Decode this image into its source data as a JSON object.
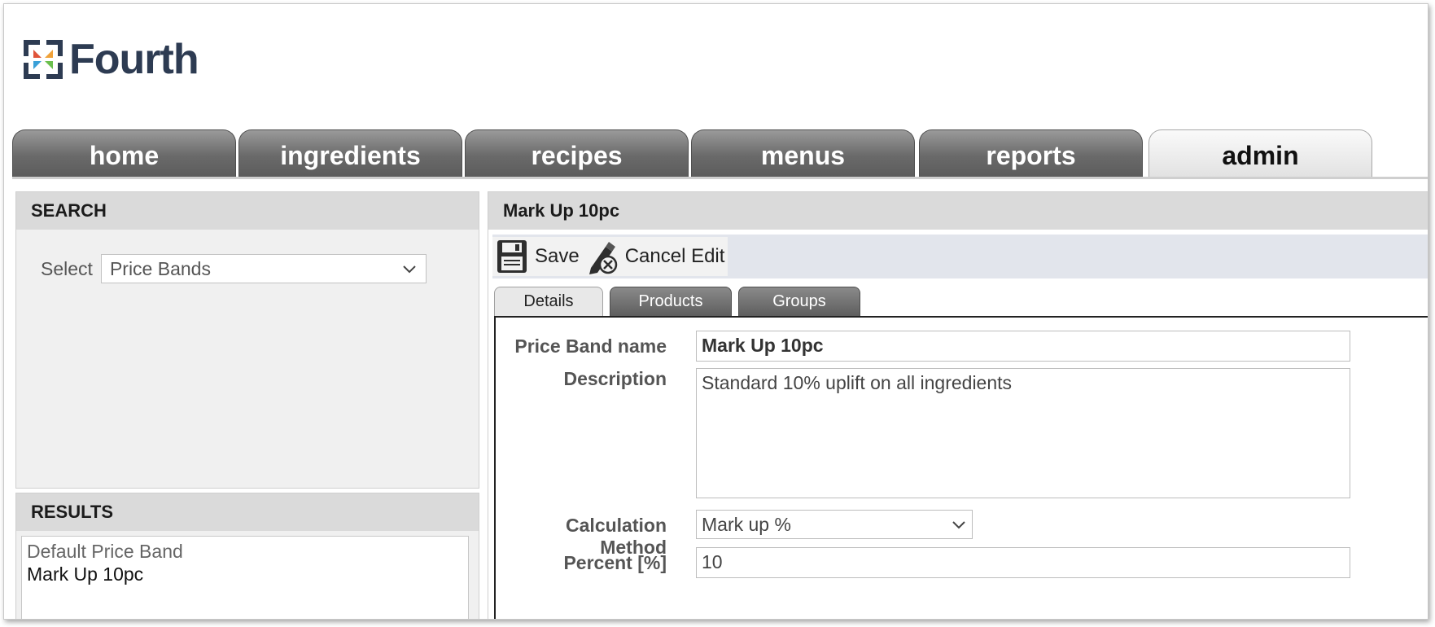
{
  "brand": {
    "name": "Fourth"
  },
  "nav": {
    "tabs": [
      {
        "label": "home",
        "active": false
      },
      {
        "label": "ingredients",
        "active": false
      },
      {
        "label": "recipes",
        "active": false
      },
      {
        "label": "menus",
        "active": false
      },
      {
        "label": "reports",
        "active": false
      },
      {
        "label": "admin",
        "active": true
      }
    ]
  },
  "search": {
    "header": "SEARCH",
    "select_label": "Select",
    "select_value": "Price Bands"
  },
  "results": {
    "header": "RESULTS",
    "items": [
      "Default Price Band",
      "Mark Up 10pc"
    ]
  },
  "detail": {
    "title": "Mark Up 10pc",
    "toolbar": {
      "save_label": "Save",
      "cancel_label": "Cancel Edit"
    },
    "subtabs": [
      {
        "label": "Details",
        "active": true
      },
      {
        "label": "Products",
        "active": false
      },
      {
        "label": "Groups",
        "active": false
      }
    ],
    "form": {
      "name_label": "Price Band name",
      "name_value": "Mark Up 10pc",
      "description_label": "Description",
      "description_value": "Standard 10% uplift on all ingredients",
      "method_label": "Calculation Method",
      "method_value": "Mark up %",
      "percent_label": "Percent [%]",
      "percent_value": "10"
    }
  },
  "colors": {
    "tab_active_bg": "#ececec",
    "tab_inactive_bg": "#6a6a6a",
    "panel_header_bg": "#dadada",
    "toolbar_bg": "#e2e5ec"
  }
}
